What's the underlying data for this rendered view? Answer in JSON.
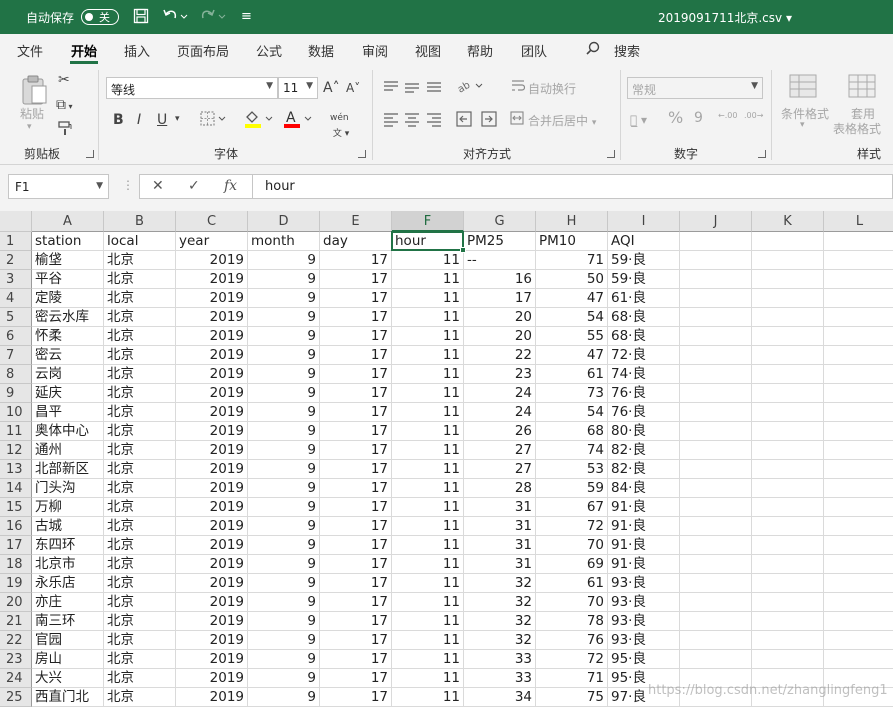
{
  "titlebar": {
    "autosave_label": "自动保存",
    "autosave_state": "关",
    "filename": "2019091711北京.csv",
    "filename_arrow": "▾",
    "qat_more": "≡"
  },
  "tabs": [
    "文件",
    "开始",
    "插入",
    "页面布局",
    "公式",
    "数据",
    "审阅",
    "视图",
    "帮助",
    "团队"
  ],
  "search_label": "搜索",
  "ribbon": {
    "clipboard": {
      "paste": "粘贴",
      "label": "剪贴板"
    },
    "font": {
      "name": "等线",
      "size": "11",
      "grow": "A˄",
      "shrink": "A˅",
      "bold": "B",
      "italic": "I",
      "underline": "U",
      "label": "字体",
      "phonetic": "wén"
    },
    "alignment": {
      "wrap": "自动换行",
      "merge": "合并后居中",
      "label": "对齐方式"
    },
    "number": {
      "format": "常规",
      "label": "数字",
      "percent": "%",
      "comma": "9",
      "inc_decimal": "←.00",
      "dec_decimal": ".00→"
    },
    "styles": {
      "conditional": "条件格式",
      "table_l1": "套用",
      "table_l2": "表格格式",
      "label": "样式"
    }
  },
  "formula_bar": {
    "name_box": "F1",
    "cancel": "✕",
    "enter": "✓",
    "fx": "fx",
    "content": "hour"
  },
  "columns": [
    "A",
    "B",
    "C",
    "D",
    "E",
    "F",
    "G",
    "H",
    "I",
    "J",
    "K",
    "L"
  ],
  "selected_column": "F",
  "headers": [
    "station",
    "local",
    "year",
    "month",
    "day",
    "hour",
    "PM25",
    "PM10",
    "AQI"
  ],
  "rows": [
    [
      "榆垡",
      "北京",
      "2019",
      "9",
      "17",
      "11",
      "--",
      "71",
      "59·良"
    ],
    [
      "平谷",
      "北京",
      "2019",
      "9",
      "17",
      "11",
      "16",
      "50",
      "59·良"
    ],
    [
      "定陵",
      "北京",
      "2019",
      "9",
      "17",
      "11",
      "17",
      "47",
      "61·良"
    ],
    [
      "密云水库",
      "北京",
      "2019",
      "9",
      "17",
      "11",
      "20",
      "54",
      "68·良"
    ],
    [
      "怀柔",
      "北京",
      "2019",
      "9",
      "17",
      "11",
      "20",
      "55",
      "68·良"
    ],
    [
      "密云",
      "北京",
      "2019",
      "9",
      "17",
      "11",
      "22",
      "47",
      "72·良"
    ],
    [
      "云岗",
      "北京",
      "2019",
      "9",
      "17",
      "11",
      "23",
      "61",
      "74·良"
    ],
    [
      "延庆",
      "北京",
      "2019",
      "9",
      "17",
      "11",
      "24",
      "73",
      "76·良"
    ],
    [
      "昌平",
      "北京",
      "2019",
      "9",
      "17",
      "11",
      "24",
      "54",
      "76·良"
    ],
    [
      "奥体中心",
      "北京",
      "2019",
      "9",
      "17",
      "11",
      "26",
      "68",
      "80·良"
    ],
    [
      "通州",
      "北京",
      "2019",
      "9",
      "17",
      "11",
      "27",
      "74",
      "82·良"
    ],
    [
      "北部新区",
      "北京",
      "2019",
      "9",
      "17",
      "11",
      "27",
      "53",
      "82·良"
    ],
    [
      "门头沟",
      "北京",
      "2019",
      "9",
      "17",
      "11",
      "28",
      "59",
      "84·良"
    ],
    [
      "万柳",
      "北京",
      "2019",
      "9",
      "17",
      "11",
      "31",
      "67",
      "91·良"
    ],
    [
      "古城",
      "北京",
      "2019",
      "9",
      "17",
      "11",
      "31",
      "72",
      "91·良"
    ],
    [
      "东四环",
      "北京",
      "2019",
      "9",
      "17",
      "11",
      "31",
      "70",
      "91·良"
    ],
    [
      "北京市",
      "北京",
      "2019",
      "9",
      "17",
      "11",
      "31",
      "69",
      "91·良"
    ],
    [
      "永乐店",
      "北京",
      "2019",
      "9",
      "17",
      "11",
      "32",
      "61",
      "93·良"
    ],
    [
      "亦庄",
      "北京",
      "2019",
      "9",
      "17",
      "11",
      "32",
      "70",
      "93·良"
    ],
    [
      "南三环",
      "北京",
      "2019",
      "9",
      "17",
      "11",
      "32",
      "78",
      "93·良"
    ],
    [
      "官园",
      "北京",
      "2019",
      "9",
      "17",
      "11",
      "32",
      "76",
      "93·良"
    ],
    [
      "房山",
      "北京",
      "2019",
      "9",
      "17",
      "11",
      "33",
      "72",
      "95·良"
    ],
    [
      "大兴",
      "北京",
      "2019",
      "9",
      "17",
      "11",
      "33",
      "71",
      "95·良"
    ],
    [
      "西直门北",
      "北京",
      "2019",
      "9",
      "17",
      "11",
      "34",
      "75",
      "97·良"
    ]
  ],
  "watermark": "https://blog.csdn.net/zhanglingfeng1",
  "colors": {
    "excel_green": "#217346"
  }
}
